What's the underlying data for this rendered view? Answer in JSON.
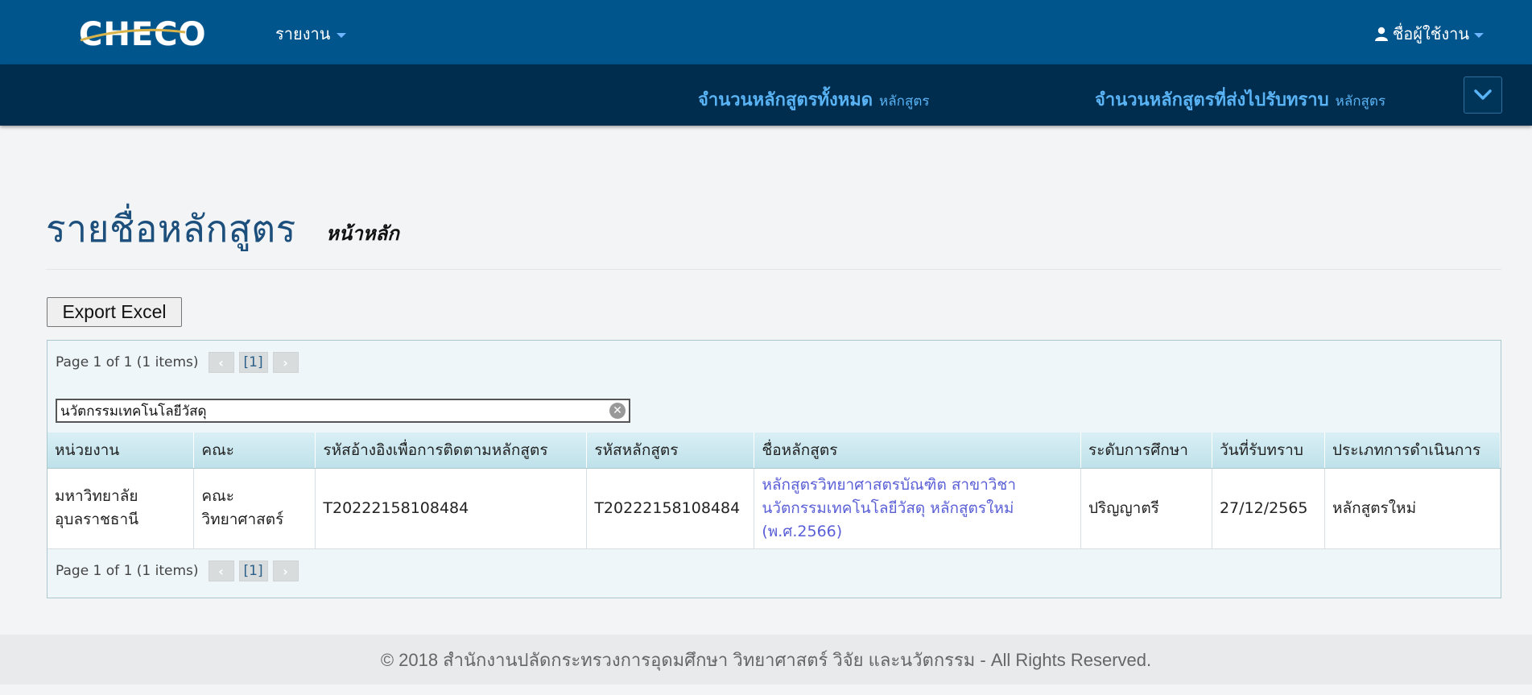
{
  "header": {
    "logo_text": "CHECO",
    "menu_report": "รายงาน",
    "user_menu": "ชื่อผู้ใช้งาน"
  },
  "stats": {
    "total_label": "จำนวนหลักสูตรทั้งหมด",
    "total_unit": "หลักสูตร",
    "sent_label": "จำนวนหลักสูตรที่ส่งไปรับทราบ",
    "sent_unit": "หลักสูตร"
  },
  "page": {
    "title": "รายชื่อหลักสูตร",
    "breadcrumb": "หน้าหลัก"
  },
  "toolbar": {
    "export_label": "Export Excel"
  },
  "pager": {
    "text": "Page 1 of 1 (1 items)",
    "current": "[1]"
  },
  "filter": {
    "value": "นวัตกรรมเทคโนโลยีวัสดุ"
  },
  "table": {
    "columns": [
      "หน่วยงาน",
      "คณะ",
      "รหัสอ้างอิงเพื่อการติดตามหลักสูตร",
      "รหัสหลักสูตร",
      "ชื่อหลักสูตร",
      "ระดับการศึกษา",
      "วันที่รับทราบ",
      "ประเภทการดำเนินการ"
    ],
    "rows": [
      {
        "agency": "มหาวิทยาลัยอุบลราชธานี",
        "faculty": "คณะวิทยาศาสตร์",
        "ref_code": "T20222158108484",
        "course_code": "T20222158108484",
        "course_name": "หลักสูตรวิทยาศาสตรบัณฑิต สาขาวิชานวัตกรรมเทคโนโลยีวัสดุ หลักสูตรใหม่ (พ.ศ.2566)",
        "level": "ปริญญาตรี",
        "date": "27/12/2565",
        "action_type": "หลักสูตรใหม่"
      }
    ]
  },
  "footer": {
    "text": "© 2018 สำนักงานปลัดกระทรวงการอุดมศึกษา วิทยาศาสตร์ วิจัย และนวัตกรรม - All Rights Reserved."
  },
  "colors": {
    "topbar": "#00558c",
    "statsbar": "#002d4d",
    "stat_text": "#5ab3f5",
    "title": "#1d4f7c",
    "link": "#5a5fd6"
  }
}
